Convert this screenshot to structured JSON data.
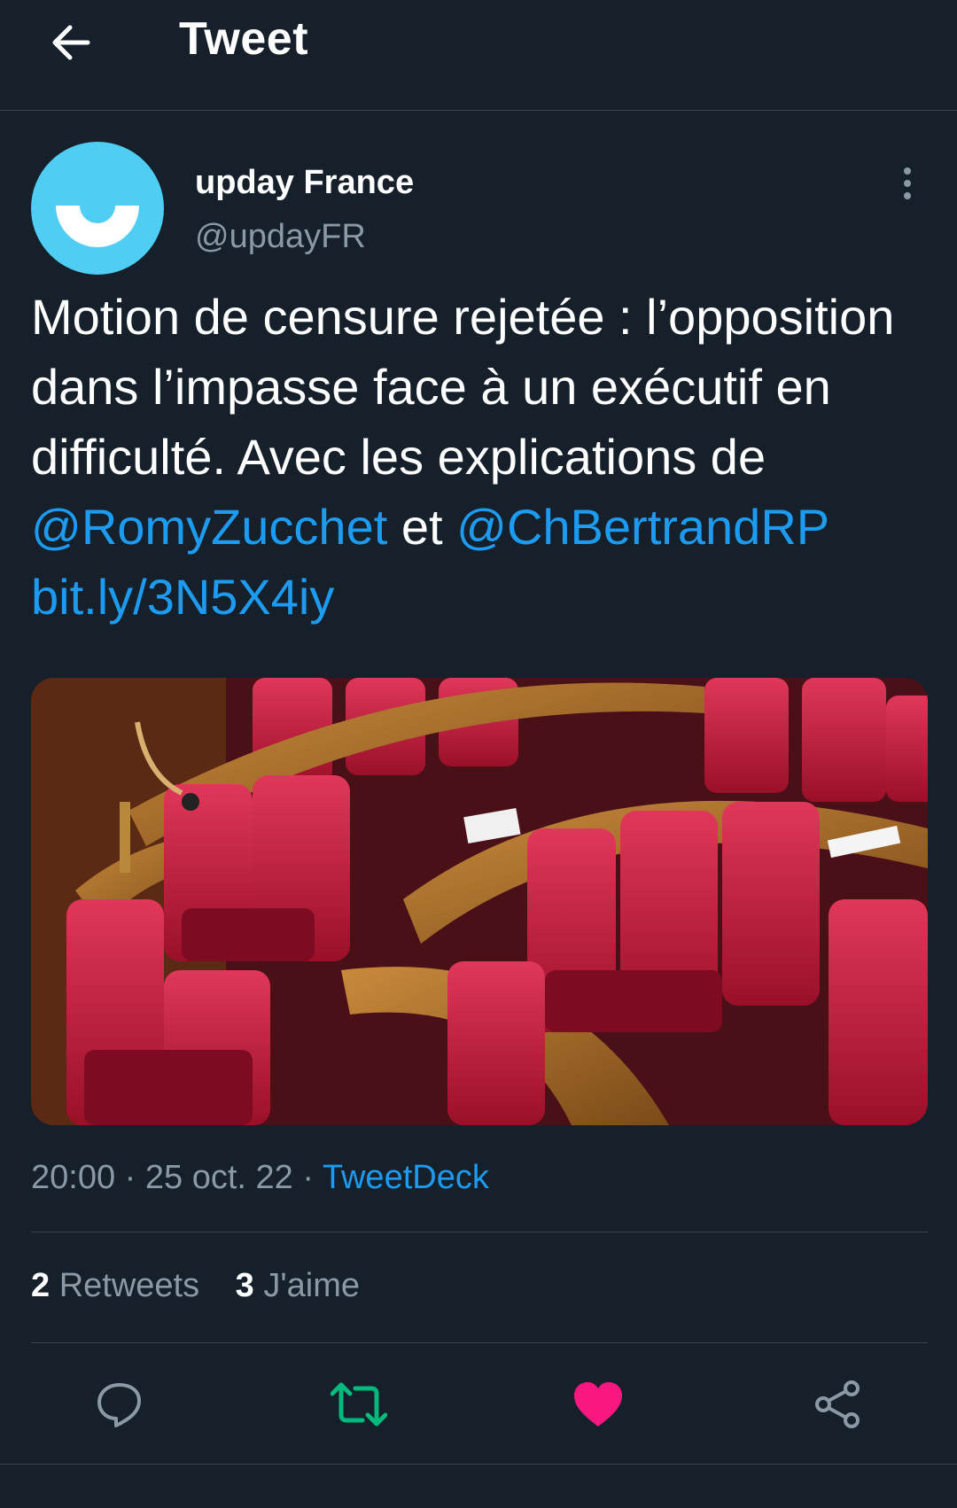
{
  "header": {
    "title": "Tweet"
  },
  "author": {
    "name": "upday France",
    "handle": "@updayFR"
  },
  "tweet": {
    "text_1": "Motion de censure rejetée : l’opposition dans l’impasse face à un exécutif en difficulté. Avec les explications de ",
    "mention_1": "@RomyZucchet",
    "text_2": " et ",
    "mention_2": "@ChBertrandRP",
    "text_3": " ",
    "link": "bit.ly/3N5X4iy"
  },
  "meta": {
    "time": "20:00",
    "sep1": " · ",
    "date": "25 oct. 22",
    "sep2": " · ",
    "source": "TweetDeck"
  },
  "stats": {
    "retweets_count": "2",
    "retweets_label": "Retweets",
    "likes_count": "3",
    "likes_label": "J'aime"
  },
  "actions": [
    {
      "icon": "reply-icon"
    },
    {
      "icon": "retweet-icon",
      "color": "#00ba7c"
    },
    {
      "icon": "like-icon",
      "color": "#f91880"
    },
    {
      "icon": "share-icon"
    }
  ],
  "colors": {
    "background": "#15202b",
    "link": "#1d9bf0",
    "secondary_text": "#8b98a5",
    "avatar": "#4fcdf3"
  }
}
